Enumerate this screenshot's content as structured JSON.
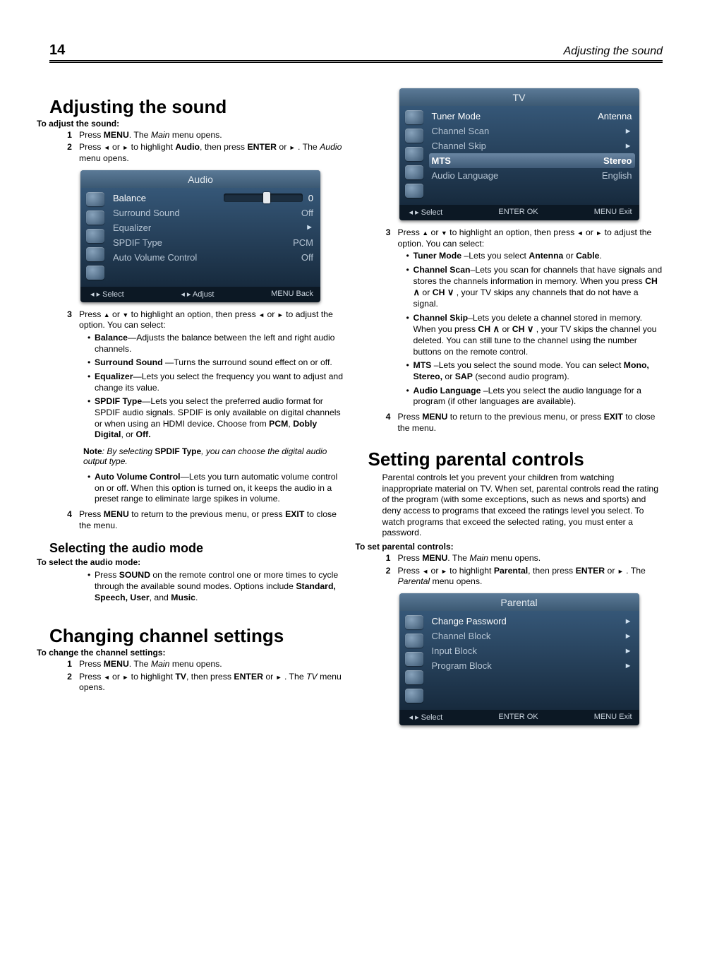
{
  "page_number": "14",
  "running_head": "Adjusting the sound",
  "sections": {
    "adjust_sound": {
      "title": "Adjusting the sound",
      "lead": "To adjust the sound:",
      "steps": {
        "s1": "Press MENU. The Main menu opens.",
        "s2a": "Press ",
        "s2b": " or ",
        "s2c": " to highlight Audio, then press ENTER or ",
        "s2d": " . The Audio menu opens.",
        "s3a": "Press ",
        "s3b": " or ",
        "s3c": " to highlight an option, then press ",
        "s3d": " or ",
        "s3e": " to adjust the option. You can select:",
        "items": {
          "balance": "Balance—Adjusts the balance between the left and right audio channels.",
          "surround": "Surround Sound —Turns the surround sound effect on or off.",
          "equalizer": "Equalizer—Lets you select the frequency you want to adjust and change its value.",
          "spdif": "SPDIF Type—Lets you select the preferred audio format for SPDIF audio signals. SPDIF is only available on digital channels or when using an HDMI device. Choose from PCM, Dobly Digital, or Off.",
          "auto_vol": "Auto Volume Control—Lets you turn automatic volume control on or off. When this option is turned on, it keeps the audio in a preset range to eliminate large spikes in volume."
        },
        "note_label": "Note",
        "note_body": ": By selecting SPDIF Type, you can choose the digital audio output type.",
        "s4": "Press MENU to return to the previous menu, or press EXIT to close the menu."
      }
    },
    "audio_mode": {
      "title": "Selecting the audio mode",
      "lead": "To select the audio mode:",
      "body": "Press SOUND on the remote control one or more times to cycle through the available sound modes. Options include Standard, Speech, User, and Music."
    },
    "channel_settings": {
      "title": "Changing channel settings",
      "lead": "To change the channel settings:",
      "s1": "Press MENU. The Main menu opens.",
      "s2a": "Press ",
      "s2b": " or ",
      "s2c": " to highlight TV, then press ENTER or ",
      "s2d": " . The TV menu opens.",
      "s3a": "Press ",
      "s3b": " or ",
      "s3c": " to highlight an option, then press ",
      "s3d": " or ",
      "s3e": " to adjust the option. You can select:",
      "items": {
        "tuner": "Tuner Mode –Lets you select Antenna or Cable.",
        "scan_a": "Channel Scan–Lets you scan for channels that have signals and stores the channels information in memory. When you press CH ",
        "scan_b": " or CH ",
        "scan_c": " , your TV skips any channels that do not have a signal.",
        "skip_a": "Channel Skip–Lets you delete a channel stored in memory. When you press CH ",
        "skip_b": " or CH ",
        "skip_c": " , your TV skips the channel you deleted. You can still tune to the channel using the number buttons on the remote control.",
        "mts": "MTS –Lets you select the sound mode. You can select Mono, Stereo, or SAP (second audio program).",
        "audio_lang": "Audio Language –Lets you select the audio language for a program (if other languages are available)."
      },
      "s4": "Press MENU to return to the previous menu, or press EXIT to close the menu."
    },
    "parental": {
      "title": "Setting parental controls",
      "intro": "Parental controls let you prevent your children from watching inappropriate material on TV. When set, parental controls read the rating of the program (with some exceptions, such as news and sports) and deny access to programs that exceed the ratings level you select. To watch programs that exceed the selected rating, you must enter a password.",
      "lead": "To set parental controls:",
      "s1": "Press MENU. The Main menu opens.",
      "s2a": "Press ",
      "s2b": " or ",
      "s2c": " to highlight Parental, then press ENTER or ",
      "s2d": " . The Parental menu opens."
    }
  },
  "osd": {
    "audio": {
      "title": "Audio",
      "rows": {
        "balance": "Balance",
        "balance_val": "0",
        "surround": "Surround Sound",
        "surround_val": "Off",
        "equalizer": "Equalizer",
        "spdif": "SPDIF Type",
        "spdif_val": "PCM",
        "autovol": "Auto Volume Control",
        "autovol_val": "Off"
      },
      "foot": {
        "select": "Select",
        "adjust": "Adjust",
        "back": "MENU Back"
      }
    },
    "tv": {
      "title": "TV",
      "rows": {
        "tuner": "Tuner Mode",
        "tuner_val": "Antenna",
        "scan": "Channel Scan",
        "skip": "Channel Skip",
        "mts": "MTS",
        "mts_val": "Stereo",
        "audio_lang": "Audio Language",
        "audio_lang_val": "English"
      },
      "foot": {
        "select": "Select",
        "enter": "ENTER OK",
        "exit": "MENU Exit"
      }
    },
    "parental": {
      "title": "Parental",
      "rows": {
        "pw": "Change Password",
        "cb": "Channel Block",
        "ib": "Input Block",
        "pb": "Program Block"
      },
      "foot": {
        "select": "Select",
        "enter": "ENTER OK",
        "exit": "MENU Exit"
      }
    }
  }
}
